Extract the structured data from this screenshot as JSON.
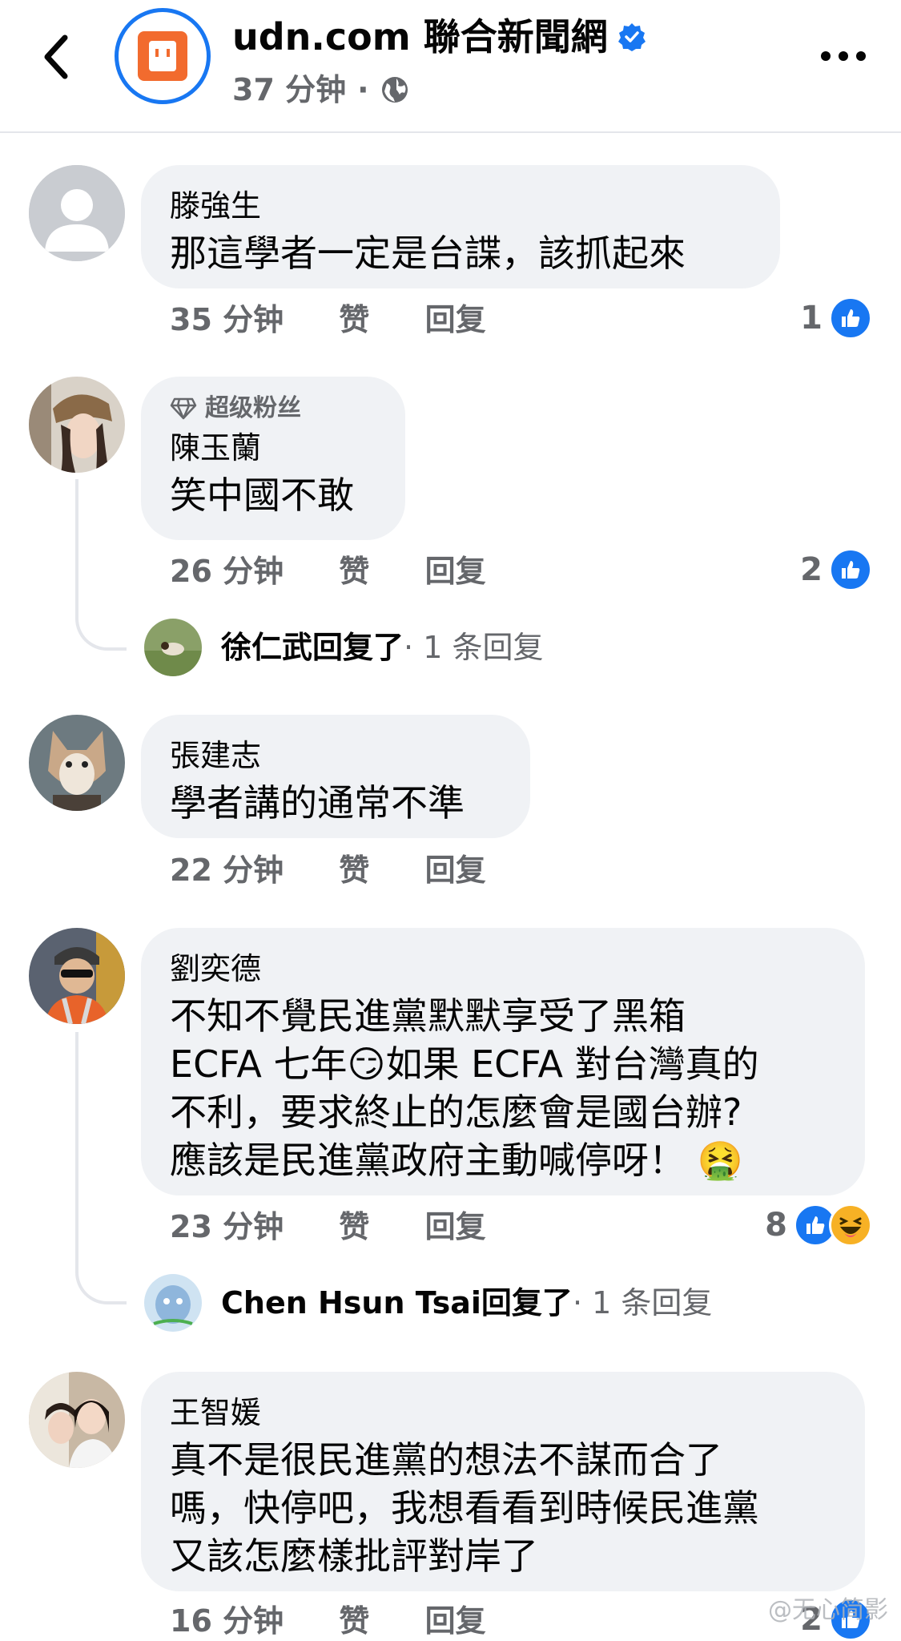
{
  "header": {
    "page_name": "udn.com 聯合新聞網",
    "time": "37 分钟",
    "dot": "·",
    "icons": [
      "back-icon",
      "udn-logo",
      "verified-icon",
      "globe-icon",
      "more-icon"
    ]
  },
  "comments": [
    {
      "author": "滕強生",
      "text": "那這學者一定是台諜，該抓起來",
      "time": "35 分钟",
      "like_label": "赞",
      "reply_label": "回复",
      "reaction_count": "1"
    },
    {
      "badge": "超级粉丝",
      "author": "陳玉蘭",
      "text": "笑中國不敢",
      "time": "26 分钟",
      "like_label": "赞",
      "reply_label": "回复",
      "reaction_count": "2",
      "reply": {
        "name": "徐仁武",
        "suffix": "回复了",
        "count": " · 1 条回复"
      }
    },
    {
      "author": "張建志",
      "text": "學者講的通常不準",
      "time": "22 分钟",
      "like_label": "赞",
      "reply_label": "回复"
    },
    {
      "author": "劉奕德",
      "text_lines": [
        "不知不覺民進黨默默享受了黑箱",
        "ECFA 七年😏如果 ECFA 對台灣真的",
        "不利，要求終止的怎麼會是國台辦?",
        "應該是民進黨政府主動喊停呀！ 🤮"
      ],
      "time": "23 分钟",
      "like_label": "赞",
      "reply_label": "回复",
      "reaction_count": "8",
      "reply": {
        "name": "Chen Hsun Tsai",
        "suffix": "回复了",
        "count": " · 1 条回复"
      }
    },
    {
      "author": "王智媛",
      "text_lines": [
        "真不是很民進黨的想法不謀而合了",
        "嗎，快停吧，我想看看到時候民進黨",
        "又該怎麼樣批評對岸了"
      ],
      "time": "16 分钟",
      "like_label": "赞",
      "reply_label": "回复",
      "reaction_count": "2"
    }
  ],
  "watermark": "@无心简影",
  "colors": {
    "accent": "#1877f2",
    "bubble": "#f0f2f5",
    "secondary_text": "#65676b"
  }
}
